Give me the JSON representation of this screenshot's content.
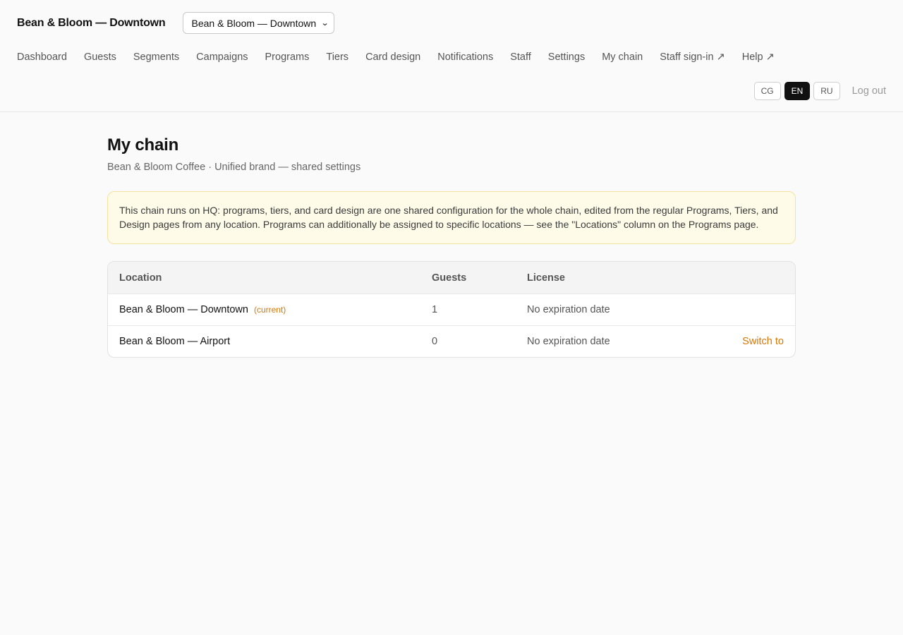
{
  "brand": "Bean & Bloom — Downtown",
  "location_select": {
    "value": "Bean & Bloom — Downtown"
  },
  "nav": [
    {
      "label": "Dashboard",
      "name": "nav-dashboard"
    },
    {
      "label": "Guests",
      "name": "nav-guests"
    },
    {
      "label": "Segments",
      "name": "nav-segments"
    },
    {
      "label": "Campaigns",
      "name": "nav-campaigns"
    },
    {
      "label": "Programs",
      "name": "nav-programs"
    },
    {
      "label": "Tiers",
      "name": "nav-tiers"
    },
    {
      "label": "Card design",
      "name": "nav-card-design"
    },
    {
      "label": "Notifications",
      "name": "nav-notifications"
    },
    {
      "label": "Staff",
      "name": "nav-staff"
    },
    {
      "label": "Settings",
      "name": "nav-settings"
    },
    {
      "label": "My chain",
      "name": "nav-my-chain"
    },
    {
      "label": "Staff sign-in ↗",
      "name": "nav-staff-sign-in"
    },
    {
      "label": "Help ↗",
      "name": "nav-help"
    }
  ],
  "languages": {
    "cg": "CG",
    "en": "EN",
    "ru": "RU",
    "active": "EN"
  },
  "logout_label": "Log out",
  "page": {
    "title": "My chain",
    "subtitle": "Bean & Bloom Coffee · Unified brand — shared settings",
    "notice": "This chain runs on HQ: programs, tiers, and card design are one shared configuration for the whole chain, edited from the regular Programs, Tiers, and Design pages from any location. Programs can additionally be assigned to specific locations — see the \"Locations\" column on the Programs page."
  },
  "table": {
    "headers": {
      "location": "Location",
      "guests": "Guests",
      "license": "License"
    },
    "rows": [
      {
        "location": "Bean & Bloom — Downtown",
        "tag": "(current)",
        "guests": "1",
        "license": "No expiration date",
        "action": ""
      },
      {
        "location": "Bean & Bloom — Airport",
        "tag": "",
        "guests": "0",
        "license": "No expiration date",
        "action": "Switch to"
      }
    ]
  },
  "colors": {
    "accent": "#d97706",
    "notice_bg": "#fefbe8",
    "active_lang_bg": "#111111"
  }
}
